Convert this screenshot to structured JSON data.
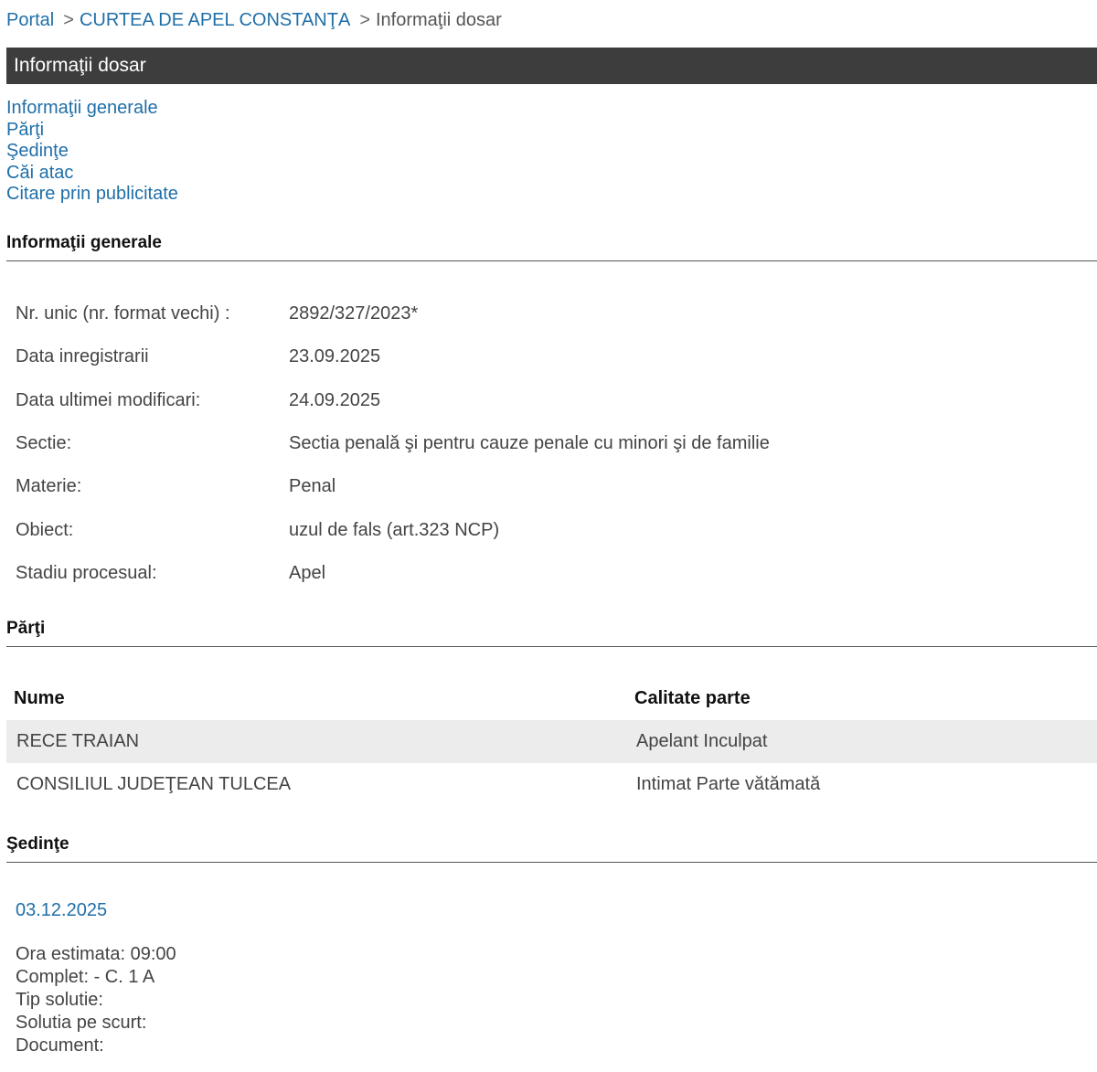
{
  "breadcrumb": {
    "portal": "Portal",
    "sep": ">",
    "court": "CURTEA DE APEL CONSTANŢA",
    "current": "Informaţii dosar"
  },
  "title": "Informaţii dosar",
  "anchors": [
    "Informaţii generale",
    "Părţi",
    "Şedinţe",
    "Căi atac",
    "Citare prin publicitate"
  ],
  "sections": {
    "general": "Informaţii generale",
    "parties": "Părţi",
    "hearings": "Şedinţe"
  },
  "general_info": [
    {
      "label": "Nr. unic (nr. format vechi) :",
      "value": "2892/327/2023*"
    },
    {
      "label": "Data inregistrarii",
      "value": "23.09.2025"
    },
    {
      "label": "Data ultimei modificari:",
      "value": "24.09.2025"
    },
    {
      "label": "Sectie:",
      "value": "Sectia penală şi pentru cauze penale cu minori şi de familie"
    },
    {
      "label": "Materie:",
      "value": "Penal"
    },
    {
      "label": "Obiect:",
      "value": "uzul de fals (art.323 NCP)"
    },
    {
      "label": "Stadiu procesual:",
      "value": "Apel"
    }
  ],
  "parties": {
    "headers": [
      "Nume",
      "Calitate parte"
    ],
    "rows": [
      [
        "RECE TRAIAN",
        "Apelant Inculpat"
      ],
      [
        "CONSILIUL JUDEŢEAN TULCEA",
        "Intimat Parte vătămată"
      ]
    ]
  },
  "hearing": {
    "date": "03.12.2025",
    "lines": [
      "Ora estimata: 09:00",
      "Complet: - C. 1 A",
      "Tip solutie:",
      "Solutia pe scurt:",
      "Document:"
    ]
  },
  "colors": {
    "link": "#1f6fa8",
    "title_bar": "#3d3d3d",
    "row_alt": "#ececec"
  }
}
